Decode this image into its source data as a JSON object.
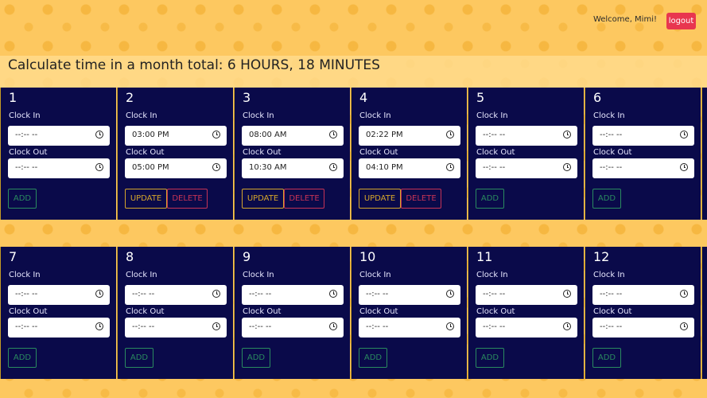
{
  "header": {
    "welcome": "Welcome, Mimi!",
    "logout_label": "logout"
  },
  "summary": {
    "text": "Calculate time in a month total: 6 HOURS, 18 MINUTES"
  },
  "labels": {
    "clock_in": "Clock In",
    "clock_out": "Clock Out",
    "add": "ADD",
    "update": "UPDATE",
    "delete": "DELETE",
    "empty": "--:-- --"
  },
  "days": [
    {
      "num": "1",
      "clock_in": "--:-- --",
      "clock_out": "--:-- --",
      "mode": "add"
    },
    {
      "num": "2",
      "clock_in": "03:00 PM",
      "clock_out": "05:00 PM",
      "mode": "edit"
    },
    {
      "num": "3",
      "clock_in": "08:00 AM",
      "clock_out": "10:30 AM",
      "mode": "edit"
    },
    {
      "num": "4",
      "clock_in": "02:22 PM",
      "clock_out": "04:10 PM",
      "mode": "edit"
    },
    {
      "num": "5",
      "clock_in": "--:-- --",
      "clock_out": "--:-- --",
      "mode": "add"
    },
    {
      "num": "6",
      "clock_in": "--:-- --",
      "clock_out": "--:-- --",
      "mode": "add"
    },
    {
      "num": "7",
      "clock_in": "--:-- --",
      "clock_out": "--:-- --",
      "mode": "add"
    },
    {
      "num": "8",
      "clock_in": "--:-- --",
      "clock_out": "--:-- --",
      "mode": "add"
    },
    {
      "num": "9",
      "clock_in": "--:-- --",
      "clock_out": "--:-- --",
      "mode": "add"
    },
    {
      "num": "10",
      "clock_in": "--:-- --",
      "clock_out": "--:-- --",
      "mode": "add"
    },
    {
      "num": "11",
      "clock_in": "--:-- --",
      "clock_out": "--:-- --",
      "mode": "add"
    },
    {
      "num": "12",
      "clock_in": "--:-- --",
      "clock_out": "--:-- --",
      "mode": "add"
    }
  ]
}
